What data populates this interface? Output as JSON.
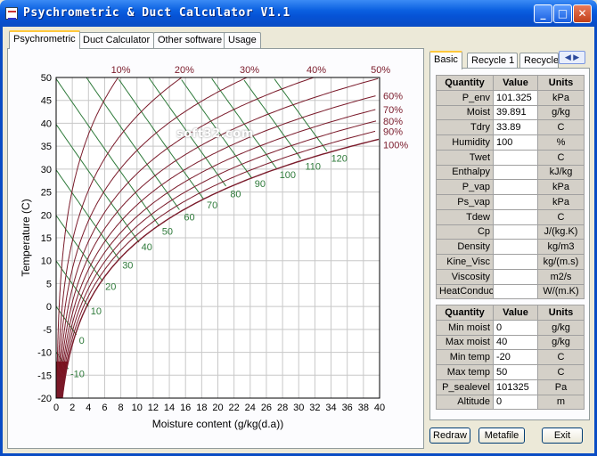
{
  "window": {
    "title": "Psychrometric & Duct Calculator V1.1",
    "minimize": "_",
    "maximize": "□",
    "close": "✕"
  },
  "tabs": [
    {
      "label": "Psychrometric",
      "active": true
    },
    {
      "label": "Duct Calculator",
      "active": false
    },
    {
      "label": "Other software",
      "active": false
    },
    {
      "label": "Usage",
      "active": false
    }
  ],
  "right_tabs": [
    {
      "label": "Basic",
      "active": true
    },
    {
      "label": "Recycle 1",
      "active": false
    },
    {
      "label": "Recycle",
      "active": false
    }
  ],
  "right_tabs_scroll": "◀ ▶",
  "basic_table": {
    "headers": [
      "Quantity",
      "Value",
      "Units"
    ],
    "rows": [
      [
        "P_env",
        "101.325",
        "kPa"
      ],
      [
        "Moist",
        "39.891",
        "g/kg"
      ],
      [
        "Tdry",
        "33.89",
        "C"
      ],
      [
        "Humidity",
        "100",
        "%"
      ],
      [
        "Twet",
        "",
        "C"
      ],
      [
        "Enthalpy",
        "",
        "kJ/kg"
      ],
      [
        "P_vap",
        "",
        "kPa"
      ],
      [
        "Ps_vap",
        "",
        "kPa"
      ],
      [
        "Tdew",
        "",
        "C"
      ],
      [
        "Cp",
        "",
        "J/(kg.K)"
      ],
      [
        "Density",
        "",
        "kg/m3"
      ],
      [
        "Kine_Visc",
        "",
        "kg/(m.s)"
      ],
      [
        "Viscosity",
        "",
        "m2/s"
      ],
      [
        "HeatConduct",
        "",
        "W/(m.K)"
      ]
    ]
  },
  "range_table": {
    "headers": [
      "Quantity",
      "Value",
      "Units"
    ],
    "rows": [
      [
        "Min moist",
        "0",
        "g/kg"
      ],
      [
        "Max moist",
        "40",
        "g/kg"
      ],
      [
        "Min temp",
        "-20",
        "C"
      ],
      [
        "Max temp",
        "50",
        "C"
      ],
      [
        "P_sealevel",
        "101325",
        "Pa"
      ],
      [
        "Altitude",
        "0",
        "m"
      ]
    ]
  },
  "buttons": {
    "redraw": "Redraw",
    "metafile": "Metafile",
    "exit": "Exit"
  },
  "watermark": "soft32.com",
  "colors": {
    "rh": "#7a1a2a",
    "enthalpy": "#2e7a3a",
    "grid": "#c8c8c8",
    "fill": "#7a0000"
  },
  "chart_data": {
    "type": "line",
    "title": "",
    "xlabel": "Moisture content (g/kg(d.a))",
    "ylabel": "Temperature (C)",
    "xlim": [
      0,
      40
    ],
    "ylim": [
      -20,
      50
    ],
    "xticks": [
      "0",
      "2",
      "4",
      "6",
      "8",
      "10",
      "12",
      "14",
      "16",
      "18",
      "20",
      "22",
      "24",
      "26",
      "28",
      "30",
      "32",
      "34",
      "36",
      "38",
      "40"
    ],
    "yticks": [
      "-20",
      "-15",
      "-10",
      "-5",
      "0",
      "5",
      "10",
      "15",
      "20",
      "25",
      "30",
      "35",
      "40",
      "45",
      "50"
    ],
    "pressure_kpa": 101.325,
    "rh_series": [
      {
        "name": "10%",
        "rh": 10
      },
      {
        "name": "20%",
        "rh": 20
      },
      {
        "name": "30%",
        "rh": 30
      },
      {
        "name": "40%",
        "rh": 40
      },
      {
        "name": "50%",
        "rh": 50
      },
      {
        "name": "60%",
        "rh": 60
      },
      {
        "name": "70%",
        "rh": 70
      },
      {
        "name": "80%",
        "rh": 80
      },
      {
        "name": "90%",
        "rh": 90
      },
      {
        "name": "100%",
        "rh": 100
      }
    ],
    "enthalpy_series": [
      {
        "name": "-10",
        "h": -10
      },
      {
        "name": "0",
        "h": 0
      },
      {
        "name": "10",
        "h": 10
      },
      {
        "name": "20",
        "h": 20
      },
      {
        "name": "30",
        "h": 30
      },
      {
        "name": "40",
        "h": 40
      },
      {
        "name": "50",
        "h": 50
      },
      {
        "name": "60",
        "h": 60
      },
      {
        "name": "70",
        "h": 70
      },
      {
        "name": "80",
        "h": 80
      },
      {
        "name": "90",
        "h": 90
      },
      {
        "name": "100",
        "h": 100
      },
      {
        "name": "110",
        "h": 110
      },
      {
        "name": "120",
        "h": 120
      }
    ]
  }
}
